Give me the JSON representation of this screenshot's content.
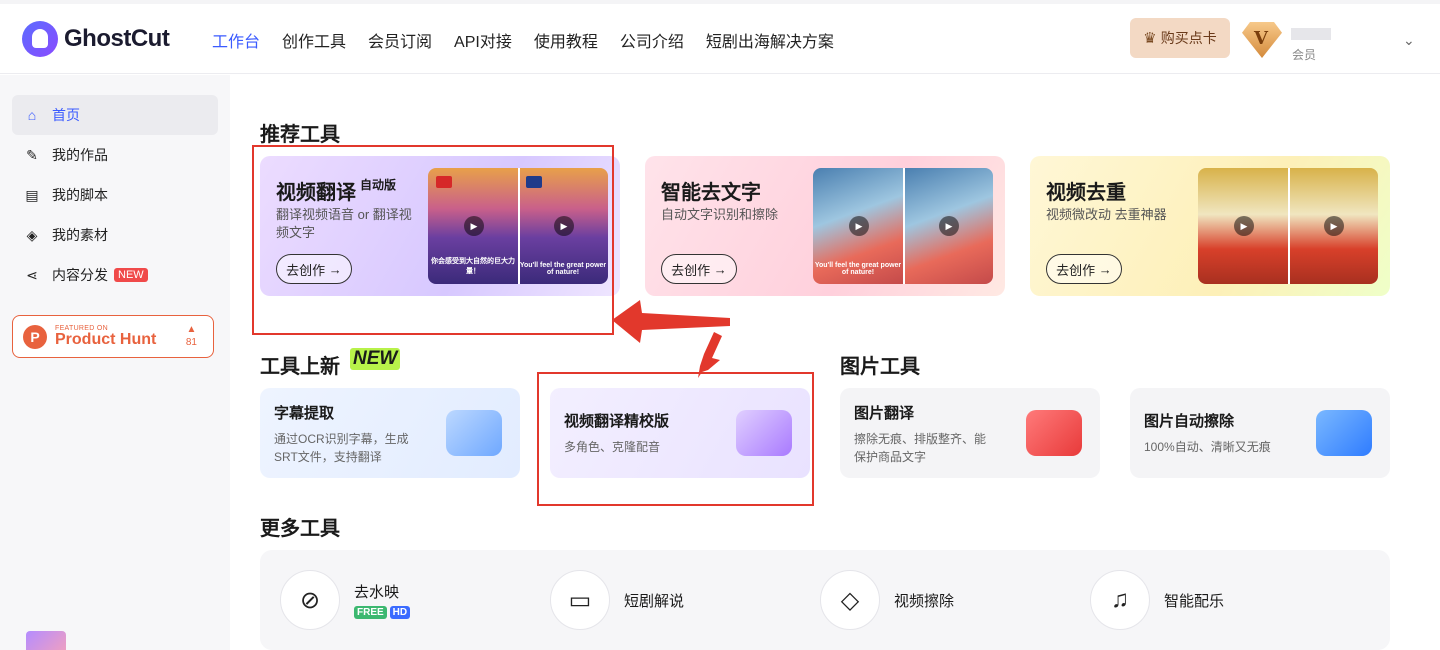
{
  "header": {
    "logo_text": "GhostCut",
    "nav": [
      "工作台",
      "创作工具",
      "会员订阅",
      "API对接",
      "使用教程",
      "公司介绍",
      "短剧出海解决方案"
    ],
    "buy_label": "购买点卡",
    "vip_letter": "V",
    "member_label": "会员"
  },
  "sidebar": {
    "items": [
      {
        "label": "首页",
        "icon": "home-icon"
      },
      {
        "label": "我的作品",
        "icon": "magic-wand-icon"
      },
      {
        "label": "我的脚本",
        "icon": "document-icon"
      },
      {
        "label": "我的素材",
        "icon": "layers-icon"
      },
      {
        "label": "内容分发",
        "icon": "share-icon",
        "badge": "NEW"
      }
    ],
    "product_hunt": {
      "featured": "FEATURED ON",
      "name": "Product Hunt",
      "votes": "81"
    }
  },
  "sections": {
    "recommended": "推荐工具",
    "new_tools": "工具上新",
    "new_word": "NEW",
    "image_tools": "图片工具",
    "more_tools": "更多工具"
  },
  "recommended": [
    {
      "title": "视频翻译",
      "sup": "自动版",
      "desc": "翻译视频语音 or 翻译视频文字",
      "cta": "去创作",
      "caption_left": "你会感受到大自然的巨大力量！",
      "caption_right": "You'll feel the great power of nature!"
    },
    {
      "title": "智能去文字",
      "desc": "自动文字识别和擦除",
      "cta": "去创作",
      "caption_left": "You'll feel the great power of nature!"
    },
    {
      "title": "视频去重",
      "desc": "视频微改动 去重神器",
      "cta": "去创作"
    }
  ],
  "new_tools": [
    {
      "title": "字幕提取",
      "desc": "通过OCR识别字幕，生成SRT文件，支持翻译"
    },
    {
      "title": "视频翻译精校版",
      "desc": "多角色、克隆配音"
    }
  ],
  "image_tools": [
    {
      "title": "图片翻译",
      "desc": "擦除无痕、排版整齐、能保护商品文字"
    },
    {
      "title": "图片自动擦除",
      "desc": "100%自动、清晰又无痕"
    }
  ],
  "more_tools": [
    {
      "label": "去水映",
      "icon": "no-water-drop-icon",
      "tags": [
        "FREE",
        "HD"
      ]
    },
    {
      "label": "短剧解说",
      "icon": "video-voice-icon"
    },
    {
      "label": "视频擦除",
      "icon": "video-eraser-icon"
    },
    {
      "label": "智能配乐",
      "icon": "music-note-icon"
    }
  ],
  "colors": {
    "accent": "#3b5bff",
    "annotation_red": "#e2382c",
    "new_badge": "#f04a4a"
  }
}
